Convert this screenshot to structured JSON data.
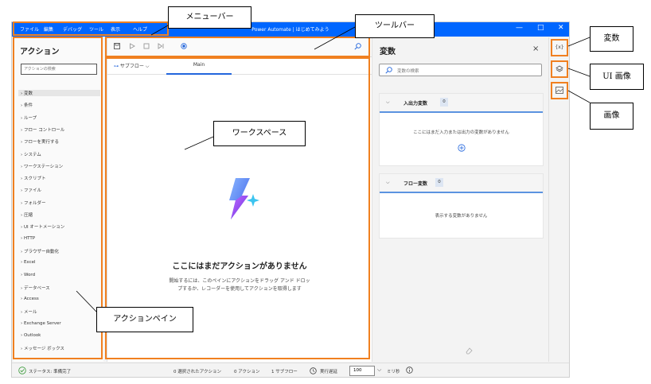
{
  "window": {
    "menu": [
      "ファイル",
      "編集",
      "デバッグ",
      "ツール",
      "表示",
      "ヘルプ"
    ],
    "title": "Power Automate | はじめてみよう",
    "controls": [
      "—",
      "□",
      "✕"
    ]
  },
  "actions_pane": {
    "title": "アクション",
    "search_placeholder": "アクションの検索",
    "items": [
      "変数",
      "条件",
      "ループ",
      "フロー コントロール",
      "フローを実行する",
      "システム",
      "ワークステーション",
      "スクリプト",
      "ファイル",
      "フォルダー",
      "圧縮",
      "UI オートメーション",
      "HTTP",
      "ブラウザー自動化",
      "Excel",
      "Word",
      "データベース",
      "Access",
      "メール",
      "Exchange Server",
      "Outlook",
      "メッセージ ボックス"
    ]
  },
  "workspace": {
    "toolbar_icons": [
      "save-icon",
      "run-icon",
      "stop-icon",
      "step-icon",
      "record-icon",
      "search-icon"
    ],
    "subflow_label": "サブフロー",
    "tab_main": "Main",
    "empty_title": "ここにはまだアクションがありません",
    "empty_desc_line1": "開始するには、このペインにアクションをドラッグ アンド ドロッ",
    "empty_desc_line2": "プするか、レコーダーを使用してアクションを取得します"
  },
  "variables_pane": {
    "title": "変数",
    "close": "×",
    "search_placeholder": "変数の検索",
    "io_section": {
      "label": "入出力変数",
      "count": "0",
      "message": "ここにはまだ入力または出力の変数がありません"
    },
    "flow_section": {
      "label": "フロー変数",
      "count": "0",
      "message": "表示する変数がありません"
    }
  },
  "side_strip": {
    "variables_button": "{x}",
    "ui_images_icon": "layers-icon",
    "images_icon": "image-icon"
  },
  "status_bar": {
    "status": "ステータス: 準備完了",
    "selected_actions": "0 選択されたアクション",
    "actions": "0 アクション",
    "subflows": "1 サブフロー",
    "delay_label": "実行遅延",
    "delay_value": "100",
    "delay_unit": "ミリ秒"
  },
  "callouts": {
    "menubar": "メニューバー",
    "toolbar": "ツールバー",
    "workspace": "ワークスペース",
    "actions_pane": "アクションペイン",
    "variables": "変数",
    "ui_images": "UI 画像",
    "images": "画像"
  },
  "colors": {
    "highlight": "#f08020",
    "titlebar": "#0066ff",
    "accent": "#2266dd"
  }
}
